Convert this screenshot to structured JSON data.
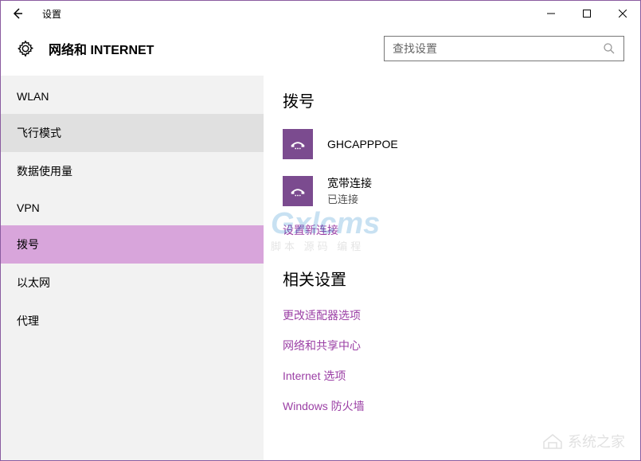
{
  "titlebar": {
    "title": "设置"
  },
  "header": {
    "heading": "网络和 INTERNET",
    "search_placeholder": "查找设置"
  },
  "sidebar": {
    "items": [
      {
        "label": "WLAN",
        "key": "wlan"
      },
      {
        "label": "飞行模式",
        "key": "airplane"
      },
      {
        "label": "数据使用量",
        "key": "datausage"
      },
      {
        "label": "VPN",
        "key": "vpn"
      },
      {
        "label": "拨号",
        "key": "dialup"
      },
      {
        "label": "以太网",
        "key": "ethernet"
      },
      {
        "label": "代理",
        "key": "proxy"
      }
    ],
    "hovered": "airplane",
    "selected": "dialup"
  },
  "content": {
    "title": "拨号",
    "connections": [
      {
        "name": "GHCAPPPOE",
        "status": ""
      },
      {
        "name": "宽带连接",
        "status": "已连接"
      }
    ],
    "new_connection_link": "设置新连接",
    "related_title": "相关设置",
    "related_links": [
      "更改适配器选项",
      "网络和共享中心",
      "Internet 选项",
      "Windows 防火墙"
    ]
  },
  "watermark": {
    "main": "Gxlcms",
    "sub": "脚本 源码 编程",
    "footer": "系统之家"
  }
}
